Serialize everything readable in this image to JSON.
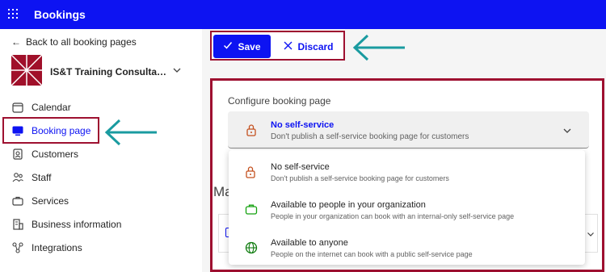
{
  "topbar": {
    "app_title": "Bookings"
  },
  "sidebar": {
    "back_label": "Back to all booking pages",
    "business_name": "IS&T Training Consultatio...",
    "items": [
      {
        "label": "Calendar",
        "icon": "calendar-icon"
      },
      {
        "label": "Booking page",
        "icon": "monitor-icon"
      },
      {
        "label": "Customers",
        "icon": "customers-icon"
      },
      {
        "label": "Staff",
        "icon": "staff-icon"
      },
      {
        "label": "Services",
        "icon": "services-icon"
      },
      {
        "label": "Business information",
        "icon": "building-icon"
      },
      {
        "label": "Integrations",
        "icon": "integrations-icon"
      }
    ],
    "active_item": "Booking page"
  },
  "toolbar": {
    "save_label": "Save",
    "discard_label": "Discard"
  },
  "config": {
    "label": "Configure booking page",
    "selected": {
      "title": "No self-service",
      "description": "Don't publish a self-service booking page for customers"
    },
    "options": [
      {
        "title": "No self-service",
        "description": "Don't publish a self-service booking page for customers",
        "icon": "lock-icon",
        "color": "#c4501e"
      },
      {
        "title": "Available to people in your organization",
        "description": "People in your organization can book with an internal-only self-service page",
        "icon": "briefcase-icon",
        "color": "#13a10e"
      },
      {
        "title": "Available to anyone",
        "description": "People on the internet can book with a public self-service page",
        "icon": "globe-icon",
        "color": "#107c10"
      }
    ]
  },
  "background": {
    "heading_fragment": "Ma"
  },
  "colors": {
    "accent": "#0d13f2",
    "highlight": "#9e1030",
    "annotation_arrow": "#1a9ba0"
  }
}
